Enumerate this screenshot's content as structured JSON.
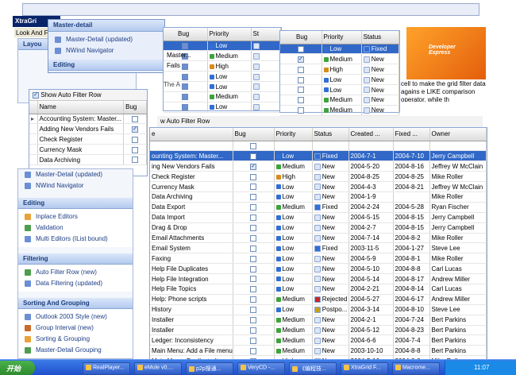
{
  "topbar": {
    "menu_items": [
      "Look And F"
    ],
    "logo_text": "Developer Express"
  },
  "popup": {
    "header": "Master-detail",
    "items": [
      "Master-Detail (updated)",
      "NWind Navigator"
    ],
    "section2": "Editing"
  },
  "nav_left": {
    "title": "XtraGri",
    "first_section": "Layou",
    "sections": [
      {
        "title": "Editing",
        "items": [
          "Inplace Editors",
          "Validation",
          "Multi Editors (IList bound)"
        ]
      },
      {
        "title": "Filtering",
        "items": [
          "Auto Filter Row (new)",
          "Data Filtering (updated)"
        ]
      },
      {
        "title": "Sorting And Grouping",
        "items": [
          "Outlook 2003 Style (new)",
          "Group Interval (new)",
          "Sorting & Grouping",
          "Master-Detail Grouping"
        ]
      }
    ],
    "md_items": [
      "Master-Detail (updated)",
      "NWind Navigator"
    ]
  },
  "small_grid": {
    "checkbox_label": "Show Auto Filter Row",
    "columns": [
      "Name",
      "Bug"
    ],
    "rows": [
      {
        "name": "Accounting System: Master...",
        "bug": false
      },
      {
        "name": "Adding New Vendors Fails",
        "bug": true
      },
      {
        "name": "Check Register",
        "bug": false
      },
      {
        "name": "Currency Mask",
        "bug": false
      },
      {
        "name": "Data Archiving",
        "bug": false
      }
    ]
  },
  "mid_grid": {
    "columns": [
      "Bug",
      "Priority",
      "St"
    ],
    "row_labels": [
      "Master...",
      "Fails"
    ],
    "priorities": [
      "Low",
      "Medium",
      "High",
      "Low",
      "Low",
      "Medium",
      "Low"
    ],
    "note": "The A"
  },
  "right_grid": {
    "columns": [
      "Bug",
      "Priority",
      "Status"
    ],
    "priorities": [
      "Low",
      "Medium",
      "High",
      "Low",
      "Low",
      "Medium",
      "Medium"
    ],
    "statuses": [
      "Fixed",
      "New",
      "New",
      "New",
      "New",
      "New",
      "New"
    ],
    "tip": "cell to make the grid filter data agains e LIKE comparison operator, while th"
  },
  "main_grid": {
    "caption": "w Auto Filter Row",
    "columns": [
      "e",
      "Bug",
      "Priority",
      "Status",
      "Created ...",
      "Fixed ...",
      "Owner"
    ],
    "rows": [
      {
        "name": "ounting System: Master...",
        "bug": false,
        "priority": "Low",
        "status": "Fixed",
        "created": "2004-7-1",
        "fixed": "2004-7-10",
        "owner": "Jerry Campbell"
      },
      {
        "name": "ing New Vendors Fails",
        "bug": true,
        "priority": "Medium",
        "status": "New",
        "created": "2004-5-20",
        "fixed": "2004-8-16",
        "owner": "Jeffrey W McClain"
      },
      {
        "name": "Check Register",
        "bug": false,
        "priority": "High",
        "status": "New",
        "created": "2004-8-25",
        "fixed": "2004-8-25",
        "owner": "Mike Roller"
      },
      {
        "name": "Currency Mask",
        "bug": false,
        "priority": "Low",
        "status": "New",
        "created": "2004-4-3",
        "fixed": "2004-8-21",
        "owner": "Jeffrey W McClain"
      },
      {
        "name": "Data Archiving",
        "bug": false,
        "priority": "Low",
        "status": "New",
        "created": "2004-1-9",
        "fixed": "",
        "owner": "Mike Roller"
      },
      {
        "name": "Data Export",
        "bug": false,
        "priority": "Medium",
        "status": "Fixed",
        "created": "2004-2-24",
        "fixed": "2004-5-28",
        "owner": "Ryan Fischer"
      },
      {
        "name": "Data Import",
        "bug": false,
        "priority": "Low",
        "status": "New",
        "created": "2004-5-15",
        "fixed": "2004-8-15",
        "owner": "Jerry Campbell"
      },
      {
        "name": "Drag & Drop",
        "bug": false,
        "priority": "Low",
        "status": "New",
        "created": "2004-2-7",
        "fixed": "2004-8-15",
        "owner": "Jerry Campbell"
      },
      {
        "name": "Email Attachments",
        "bug": false,
        "priority": "Low",
        "status": "New",
        "created": "2004-7-14",
        "fixed": "2004-8-2",
        "owner": "Mike Roller"
      },
      {
        "name": "Email System",
        "bug": false,
        "priority": "Low",
        "status": "Fixed",
        "created": "2003-11-5",
        "fixed": "2004-1-27",
        "owner": "Steve Lee"
      },
      {
        "name": "Faxing",
        "bug": false,
        "priority": "Low",
        "status": "New",
        "created": "2004-5-9",
        "fixed": "2004-8-1",
        "owner": "Mike Roller"
      },
      {
        "name": "Help File Duplicates",
        "bug": false,
        "priority": "Low",
        "status": "New",
        "created": "2004-5-10",
        "fixed": "2004-8-8",
        "owner": "Carl Lucas"
      },
      {
        "name": "Help File Integration",
        "bug": false,
        "priority": "Low",
        "status": "New",
        "created": "2004-5-14",
        "fixed": "2004-8-17",
        "owner": "Andrew Miller"
      },
      {
        "name": "Help File Topics",
        "bug": false,
        "priority": "Low",
        "status": "New",
        "created": "2004-2-21",
        "fixed": "2004-8-14",
        "owner": "Carl Lucas"
      },
      {
        "name": "Help: Phone scripts",
        "bug": false,
        "priority": "Medium",
        "status": "Rejected",
        "created": "2004-5-27",
        "fixed": "2004-6-17",
        "owner": "Andrew Miller"
      },
      {
        "name": "History",
        "bug": false,
        "priority": "Low",
        "status": "Postpo...",
        "created": "2004-3-14",
        "fixed": "2004-8-10",
        "owner": "Steve Lee"
      },
      {
        "name": "Installer",
        "bug": false,
        "priority": "Medium",
        "status": "New",
        "created": "2004-2-1",
        "fixed": "2004-7-24",
        "owner": "Bert Parkins"
      },
      {
        "name": "Installer",
        "bug": false,
        "priority": "Medium",
        "status": "New",
        "created": "2004-5-12",
        "fixed": "2004-8-23",
        "owner": "Bert Parkins"
      },
      {
        "name": "Ledger: Inconsistency",
        "bug": false,
        "priority": "Medium",
        "status": "New",
        "created": "2004-6-6",
        "fixed": "2004-7-4",
        "owner": "Bert Parkins"
      },
      {
        "name": "Main Menu: Add a File menu",
        "bug": false,
        "priority": "Medium",
        "status": "New",
        "created": "2003-10-10",
        "fixed": "2004-8-8",
        "owner": "Bert Parkins"
      },
      {
        "name": "Main Menu: Duplicate Items",
        "bug": false,
        "priority": "High",
        "status": "New",
        "created": "2004-5-16",
        "fixed": "2004-8-8",
        "owner": "Mike Roller"
      }
    ]
  },
  "taskbar": {
    "start": "开始",
    "buttons": [
      "RealPlayer...",
      "eMule v0....",
      "p2p搜通...",
      "VeryCD -...",
      "《编程技...",
      "XtraGrid F...",
      "Macrome..."
    ],
    "clock": "11:07"
  },
  "colors": {
    "selection": "#3168c7",
    "accent": "#1b3d7a",
    "taskbar": "#2457d4",
    "low": "#2f6fd6",
    "medium": "#3da33d",
    "high": "#d98b1b"
  }
}
